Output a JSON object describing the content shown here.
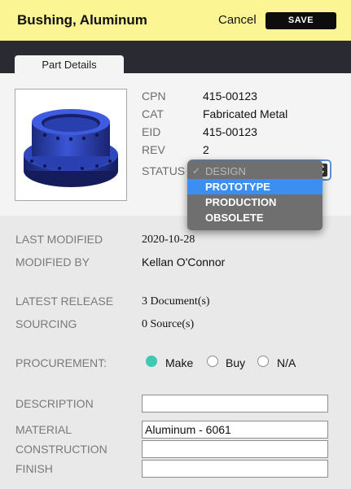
{
  "header": {
    "title": "Bushing, Aluminum",
    "cancel_label": "Cancel",
    "save_label": "SAVE"
  },
  "tabs": [
    {
      "label": "Part Details"
    }
  ],
  "part": {
    "thumbnail_icon": "bushing-3d-model",
    "meta": [
      {
        "label": "CPN",
        "value": "415-00123"
      },
      {
        "label": "CAT",
        "value": "Fabricated Metal"
      },
      {
        "label": "EID",
        "value": "415-00123"
      },
      {
        "label": "REV",
        "value": "2"
      }
    ],
    "status_label": "STATUS",
    "status_options": [
      {
        "label": "DESIGN",
        "checked": true
      },
      {
        "label": "PROTOTYPE",
        "highlighted": true
      },
      {
        "label": "PRODUCTION"
      },
      {
        "label": "OBSOLETE"
      }
    ]
  },
  "form": {
    "last_modified": {
      "label": "LAST MODIFIED",
      "value": "2020-10-28"
    },
    "modified_by": {
      "label": "MODIFIED BY",
      "value": "Kellan O'Connor"
    },
    "latest_release": {
      "label": "LATEST RELEASE",
      "count": "3",
      "text": "Document(s)"
    },
    "sourcing": {
      "label": "SOURCING",
      "count": "0",
      "text": "Source(s)"
    },
    "procurement": {
      "label": "PROCUREMENT:",
      "options": [
        {
          "label": "Make",
          "selected": true
        },
        {
          "label": "Buy",
          "selected": false
        },
        {
          "label": "N/A",
          "selected": false
        }
      ]
    },
    "description": {
      "label": "DESCRIPTION",
      "value": ""
    },
    "material": {
      "label": "MATERIAL",
      "value": "Aluminum - 6061"
    },
    "construction": {
      "label": "CONSTRUCTION",
      "value": ""
    },
    "finish": {
      "label": "FINISH",
      "value": ""
    }
  },
  "colors": {
    "header_bg": "#fcf594",
    "accent_teal": "#3ec9b5",
    "highlight_blue": "#3c8ff2",
    "tabbar_bg": "#2a2a33"
  }
}
